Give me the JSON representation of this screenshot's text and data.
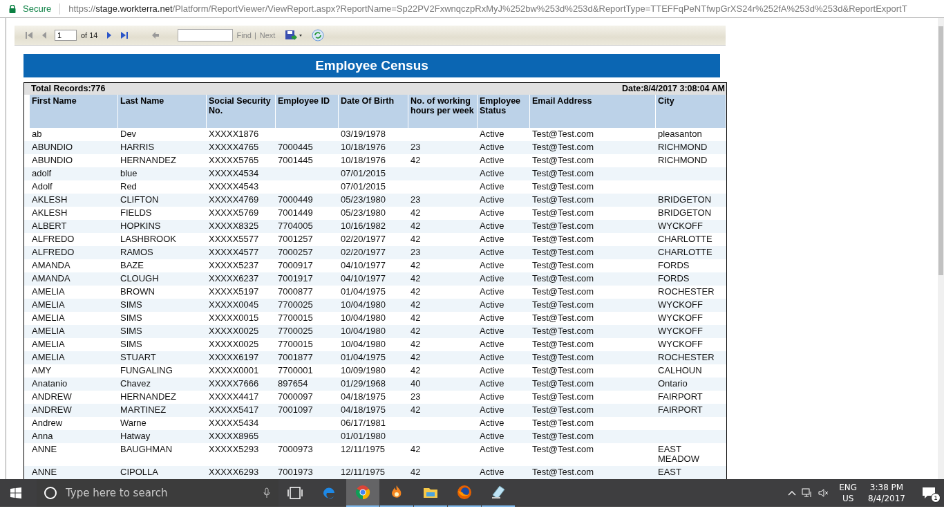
{
  "address_bar": {
    "secure_label": "Secure",
    "url_scheme": "https://",
    "url_domain": "stage.workterra.net",
    "url_path": "/Platform/ReportViewer/ViewReport.aspx?ReportName=Sp22PV2FxwnqczpRxMyJ%252bw%253d%253d&ReportType=TTEFFqPeNTfwpGrXS24r%252fA%253d%253d&ReportExportT"
  },
  "toolbar": {
    "nav_buttons": [
      {
        "kind": "first",
        "disabled": true
      },
      {
        "kind": "previous",
        "disabled": true
      }
    ],
    "page_value": "1",
    "page_count": "of 14",
    "nav_buttons_after": [
      {
        "kind": "next",
        "disabled": false
      },
      {
        "kind": "last",
        "disabled": false
      }
    ],
    "find_label": "Find",
    "separator": "|",
    "next_label": "Next"
  },
  "report": {
    "title": "Employee Census",
    "total_records": "Total Records:776",
    "date": "Date:8/4/2017 3:08:04 AM",
    "columns": [
      "First Name",
      "Last Name",
      "Social Security No.",
      "Employee ID",
      "Date Of Birth",
      "No. of working hours per week",
      "Employee Status",
      "Email Address",
      "City"
    ],
    "rows": [
      {
        "first_name": "ab",
        "last_name": "Dev",
        "ssn": "XXXXX1876",
        "dob": "03/19/1978",
        "status": "Active",
        "email": "Test@Test.com",
        "city": "pleasanton"
      },
      {
        "first_name": "ABUNDIO",
        "last_name": "HARRIS",
        "ssn": "XXXXX4765",
        "employee_id": "7000445",
        "dob": "10/18/1976",
        "hours": "23",
        "status": "Active",
        "email": "Test@Test.com",
        "city": "RICHMOND"
      },
      {
        "first_name": "ABUNDIO",
        "last_name": "HERNANDEZ",
        "ssn": "XXXXX5765",
        "employee_id": "7001445",
        "dob": "10/18/1976",
        "hours": "42",
        "status": "Active",
        "email": "Test@Test.com",
        "city": "RICHMOND"
      },
      {
        "first_name": "adolf",
        "last_name": "blue",
        "ssn": "XXXXX4534",
        "dob": "07/01/2015",
        "status": "Active",
        "email": "Test@Test.com"
      },
      {
        "first_name": "Adolf",
        "last_name": "Red",
        "ssn": "XXXXX4543",
        "dob": "07/01/2015",
        "status": "Active",
        "email": "Test@Test.com"
      },
      {
        "first_name": "AKLESH",
        "last_name": "CLIFTON",
        "ssn": "XXXXX4769",
        "employee_id": "7000449",
        "dob": "05/23/1980",
        "hours": "23",
        "status": "Active",
        "email": "Test@Test.com",
        "city": "BRIDGETON"
      },
      {
        "first_name": "AKLESH",
        "last_name": "FIELDS",
        "ssn": "XXXXX5769",
        "employee_id": "7001449",
        "dob": "05/23/1980",
        "hours": "42",
        "status": "Active",
        "email": "Test@Test.com",
        "city": "BRIDGETON"
      },
      {
        "first_name": "ALBERT",
        "last_name": "HOPKINS",
        "ssn": "XXXXX8325",
        "employee_id": "7704005",
        "dob": "10/16/1982",
        "hours": "42",
        "status": "Active",
        "email": "Test@Test.com",
        "city": "WYCKOFF"
      },
      {
        "first_name": "ALFREDO",
        "last_name": "LASHBROOK",
        "ssn": "XXXXX5577",
        "employee_id": "7001257",
        "dob": "02/20/1977",
        "hours": "42",
        "status": "Active",
        "email": "Test@Test.com",
        "city": "CHARLOTTE"
      },
      {
        "first_name": "ALFREDO",
        "last_name": "RAMOS",
        "ssn": "XXXXX4577",
        "employee_id": "7000257",
        "dob": "02/20/1977",
        "hours": "23",
        "status": "Active",
        "email": "Test@Test.com",
        "city": "CHARLOTTE"
      },
      {
        "first_name": "AMANDA",
        "last_name": "BAZE",
        "ssn": "XXXXX5237",
        "employee_id": "7000917",
        "dob": "04/10/1977",
        "hours": "42",
        "status": "Active",
        "email": "Test@Test.com",
        "city": "FORDS"
      },
      {
        "first_name": "AMANDA",
        "last_name": "CLOUGH",
        "ssn": "XXXXX6237",
        "employee_id": "7001917",
        "dob": "04/10/1977",
        "hours": "42",
        "status": "Active",
        "email": "Test@Test.com",
        "city": "FORDS"
      },
      {
        "first_name": "AMELIA",
        "last_name": "BROWN",
        "ssn": "XXXXX5197",
        "employee_id": "7000877",
        "dob": "01/04/1975",
        "hours": "42",
        "status": "Active",
        "email": "Test@Test.com",
        "city": "ROCHESTER"
      },
      {
        "first_name": "AMELIA",
        "last_name": "SIMS",
        "ssn": "XXXXX0045",
        "employee_id": "7700025",
        "dob": "10/04/1980",
        "hours": "42",
        "status": "Active",
        "email": "Test@Test.com",
        "city": "WYCKOFF"
      },
      {
        "first_name": "AMELIA",
        "last_name": "SIMS",
        "ssn": "XXXXX0015",
        "employee_id": "7700015",
        "dob": "10/04/1980",
        "hours": "42",
        "status": "Active",
        "email": "Test@Test.com",
        "city": "WYCKOFF"
      },
      {
        "first_name": "AMELIA",
        "last_name": "SIMS",
        "ssn": "XXXXX0025",
        "employee_id": "7700025",
        "dob": "10/04/1980",
        "hours": "42",
        "status": "Active",
        "email": "Test@Test.com",
        "city": "WYCKOFF"
      },
      {
        "first_name": "AMELIA",
        "last_name": "SIMS",
        "ssn": "XXXXX0025",
        "employee_id": "7700015",
        "dob": "10/04/1980",
        "hours": "42",
        "status": "Active",
        "email": "Test@Test.com",
        "city": "WYCKOFF"
      },
      {
        "first_name": "AMELIA",
        "last_name": "STUART",
        "ssn": "XXXXX6197",
        "employee_id": "7001877",
        "dob": "01/04/1975",
        "hours": "42",
        "status": "Active",
        "email": "Test@Test.com",
        "city": "ROCHESTER"
      },
      {
        "first_name": "AMY",
        "last_name": "FUNGALING",
        "ssn": "XXXXX0001",
        "employee_id": "7700001",
        "dob": "10/09/1980",
        "hours": "42",
        "status": "Active",
        "email": "Test@Test.com",
        "city": "CALHOUN"
      },
      {
        "first_name": "Anatanio",
        "last_name": "Chavez",
        "ssn": "XXXXX7666",
        "employee_id": "897654",
        "dob": "01/29/1968",
        "hours": "40",
        "status": "Active",
        "email": "Test@Test.com",
        "city": "Ontario"
      },
      {
        "first_name": "ANDREW",
        "last_name": "HERNANDEZ",
        "ssn": "XXXXX4417",
        "employee_id": "7000097",
        "dob": "04/18/1975",
        "hours": "23",
        "status": "Active",
        "email": "Test@Test.com",
        "city": "FAIRPORT"
      },
      {
        "first_name": "ANDREW",
        "last_name": "MARTINEZ",
        "ssn": "XXXXX5417",
        "employee_id": "7001097",
        "dob": "04/18/1975",
        "hours": "42",
        "status": "Active",
        "email": "Test@Test.com",
        "city": "FAIRPORT"
      },
      {
        "first_name": "Andrew",
        "last_name": "Warne",
        "ssn": "XXXXX5434",
        "dob": "06/17/1981",
        "status": "Active",
        "email": "Test@Test.com"
      },
      {
        "first_name": "Anna",
        "last_name": "Hatway",
        "ssn": "XXXXX8965",
        "dob": "01/01/1980",
        "status": "Active",
        "email": "Test@Test.com"
      },
      {
        "first_name": "ANNE",
        "last_name": "BAUGHMAN",
        "ssn": "XXXXX5293",
        "employee_id": "7000973",
        "dob": "12/11/1975",
        "hours": "42",
        "status": "Active",
        "email": "Test@Test.com",
        "city": "EAST MEADOW"
      },
      {
        "first_name": "ANNE",
        "last_name": "CIPOLLA",
        "ssn": "XXXXX6293",
        "employee_id": "7001973",
        "dob": "12/11/1975",
        "hours": "42",
        "status": "Active",
        "email": "Test@Test.com",
        "city": "EAST"
      }
    ]
  },
  "taskbar": {
    "search_placeholder": "Type here to search",
    "apps": [
      {
        "kind": "taskview",
        "running": false,
        "selected": false
      },
      {
        "kind": "edge",
        "running": false,
        "selected": false
      },
      {
        "kind": "chrome",
        "running": true,
        "selected": true
      },
      {
        "kind": "flame",
        "running": true,
        "selected": false
      },
      {
        "kind": "explorer",
        "running": true,
        "selected": false
      },
      {
        "kind": "firefox",
        "running": true,
        "selected": false
      },
      {
        "kind": "notes",
        "running": true,
        "selected": false
      }
    ],
    "language": "ENG",
    "region": "US",
    "time": "3:38 PM",
    "date": "8/4/2017",
    "notification_count": "1"
  }
}
